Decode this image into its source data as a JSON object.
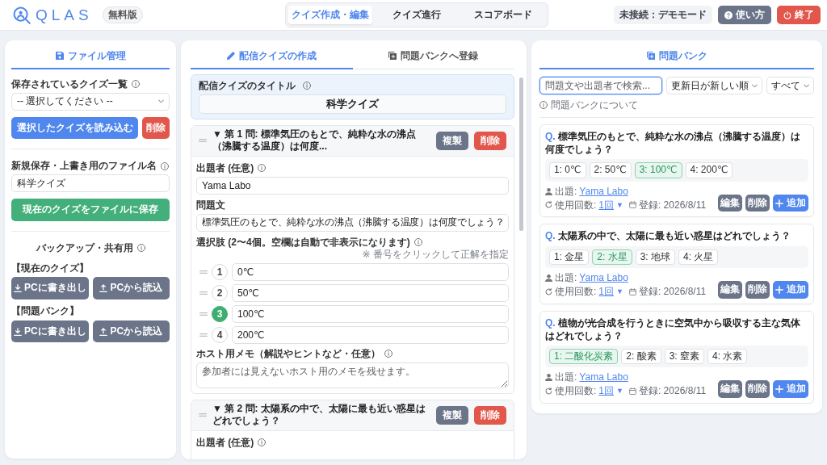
{
  "header": {
    "logo": "QLAS",
    "plan_badge": "無料版",
    "tabs": [
      {
        "label": "クイズ作成・編集",
        "selected": true
      },
      {
        "label": "クイズ進行",
        "selected": false
      },
      {
        "label": "スコアボード",
        "selected": false
      }
    ],
    "connection_status": "未接続：デモモード",
    "buttons": [
      {
        "kind": "help",
        "label": "使い方"
      },
      {
        "kind": "exit",
        "label": "終了"
      }
    ]
  },
  "file_panel": {
    "tab": "ファイル管理",
    "saved_list": {
      "label": "保存されているクイズ一覧",
      "value": "-- 選択してください --"
    },
    "load_button": "選択したクイズを読み込む",
    "delete_button": "削除",
    "filename": {
      "label": "新規保存・上書き用のファイル名",
      "value": "科学クイズ"
    },
    "save_button": "現在のクイズをファイルに保存",
    "backup_title": "バックアップ・共有用",
    "backup_groups": [
      {
        "label": "【現在のクイズ】",
        "export_button": "PCに書き出し",
        "import_button": "PCから読込"
      },
      {
        "label": "【問題バンク】",
        "export_button": "PCに書き出し",
        "import_button": "PCから読込"
      }
    ]
  },
  "editor_panel": {
    "tabs": [
      {
        "kind": "edit",
        "label": "配信クイズの作成",
        "selected": true
      },
      {
        "kind": "bank",
        "label": "問題バンクへ登録",
        "selected": false
      }
    ],
    "quiz_title": {
      "label": "配信クイズのタイトル",
      "value": "科学クイズ"
    },
    "questions": [
      {
        "header": "▼ 第 1 問: 標準気圧のもとで、純粋な水の沸点（沸騰する温度）は何度...",
        "copy_button": "複製",
        "delete_button": "削除",
        "author": {
          "label": "出題者 (任意)",
          "value": "Yama Labo"
        },
        "text": {
          "label": "問題文",
          "value": "標準気圧のもとで、純粋な水の沸点（沸騰する温度）は何度でしょう？"
        },
        "choices_label": "選択肢 (2〜4個。空欄は自動で非表示になります)",
        "choices_hint": "※ 番号をクリックして正解を指定",
        "choices": [
          {
            "number": "1",
            "value": "0℃",
            "correct": false
          },
          {
            "number": "2",
            "value": "50℃",
            "correct": false
          },
          {
            "number": "3",
            "value": "100℃",
            "correct": true
          },
          {
            "number": "4",
            "value": "200℃",
            "correct": false
          }
        ],
        "memo": {
          "label": "ホスト用メモ（解説やヒントなど・任意）",
          "placeholder": "参加者には見えないホスト用のメモを残せます。"
        }
      },
      {
        "header": "▼ 第 2 問: 太陽系の中で、太陽に最も近い惑星はどれでしょう？",
        "copy_button": "複製",
        "delete_button": "削除",
        "author": {
          "label": "出題者 (任意)"
        }
      }
    ]
  },
  "bank_panel": {
    "tab": "問題バンク",
    "search": {
      "placeholder": "問題文や出題者で検索...",
      "focused": true
    },
    "sort_select": "更新日が新しい順",
    "filter_select": "すべて",
    "about_link": "問題バンクについて",
    "items": [
      {
        "prefix": "Q.",
        "question": "標準気圧のもとで、純粋な水の沸点（沸騰する温度）は何度でしょう？",
        "choices": [
          {
            "label": "1: 0℃",
            "correct": false
          },
          {
            "label": "2: 50℃",
            "correct": false
          },
          {
            "label": "3: 100℃",
            "correct": true
          },
          {
            "label": "4: 200℃",
            "correct": false
          }
        ],
        "author_label": "出題:",
        "author": "Yama Labo",
        "usage_label": "使用回数:",
        "usage": "1回",
        "usage_caret": "▼",
        "date": "登録: 2026/8/11",
        "buttons": [
          {
            "kind": "edit",
            "label": "編集"
          },
          {
            "kind": "delete",
            "label": "削除"
          },
          {
            "kind": "add",
            "label": "追加"
          }
        ]
      },
      {
        "prefix": "Q.",
        "question": "太陽系の中で、太陽に最も近い惑星はどれでしょう？",
        "choices": [
          {
            "label": "1: 金星",
            "correct": false
          },
          {
            "label": "2: 水星",
            "correct": true
          },
          {
            "label": "3: 地球",
            "correct": false
          },
          {
            "label": "4: 火星",
            "correct": false
          }
        ],
        "author_label": "出題:",
        "author": "Yama Labo",
        "usage_label": "使用回数:",
        "usage": "1回",
        "usage_caret": "▼",
        "date": "登録: 2026/8/11",
        "buttons": [
          {
            "kind": "edit",
            "label": "編集"
          },
          {
            "kind": "delete",
            "label": "削除"
          },
          {
            "kind": "add",
            "label": "追加"
          }
        ]
      },
      {
        "prefix": "Q.",
        "question": "植物が光合成を行うときに空気中から吸収する主な気体はどれでしょう？",
        "choices": [
          {
            "label": "1: 二酸化炭素",
            "correct": true
          },
          {
            "label": "2: 酸素",
            "correct": false
          },
          {
            "label": "3: 窒素",
            "correct": false
          },
          {
            "label": "4: 水素",
            "correct": false
          }
        ],
        "author_label": "出題:",
        "author": "Yama Labo",
        "usage_label": "使用回数:",
        "usage": "1回",
        "usage_caret": "▼",
        "date": "登録: 2026/8/11",
        "buttons": [
          {
            "kind": "edit",
            "label": "編集"
          },
          {
            "kind": "delete",
            "label": "削除"
          },
          {
            "kind": "add",
            "label": "追加"
          }
        ]
      }
    ]
  }
}
